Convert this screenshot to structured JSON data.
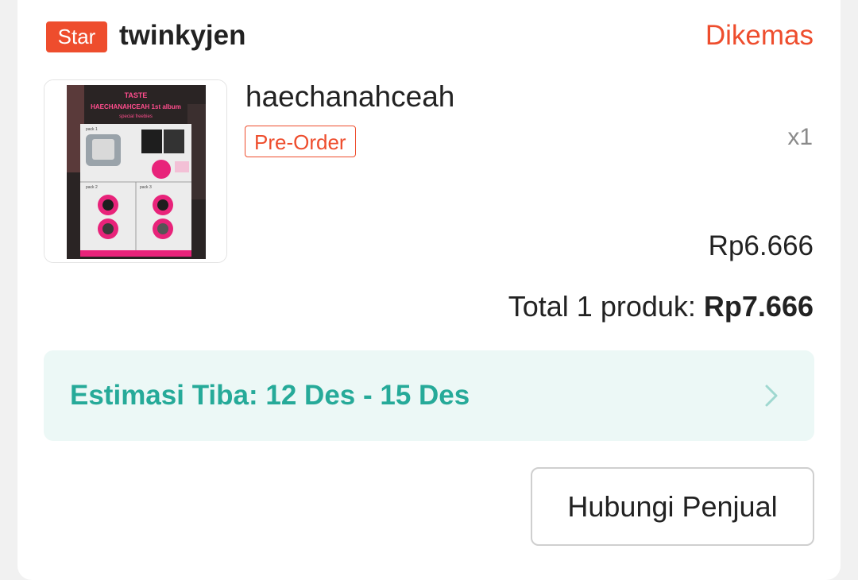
{
  "shop": {
    "badge": "Star",
    "name": "twinkyjen",
    "status": "Dikemas"
  },
  "product": {
    "name": "haechanahceah",
    "tag": "Pre-Order",
    "quantity": "x1",
    "price": "Rp6.666",
    "image_text": {
      "title_line1": "TASTE",
      "title_line2": "HAECHANAHCEAH 1st album",
      "subtitle": "special freebies",
      "pack1": "pack 1",
      "pack2": "pack 2",
      "pack3": "pack 3"
    }
  },
  "total": {
    "label": "Total 1 produk: ",
    "amount": "Rp7.666"
  },
  "eta": {
    "text": "Estimasi Tiba: 12 Des - 15 Des",
    "icon": "chevron-right-icon"
  },
  "actions": {
    "contact_seller": "Hubungi Penjual"
  },
  "colors": {
    "accent": "#ee4d2d",
    "eta_text": "#26aa99",
    "eta_bg": "#ecf8f6"
  }
}
